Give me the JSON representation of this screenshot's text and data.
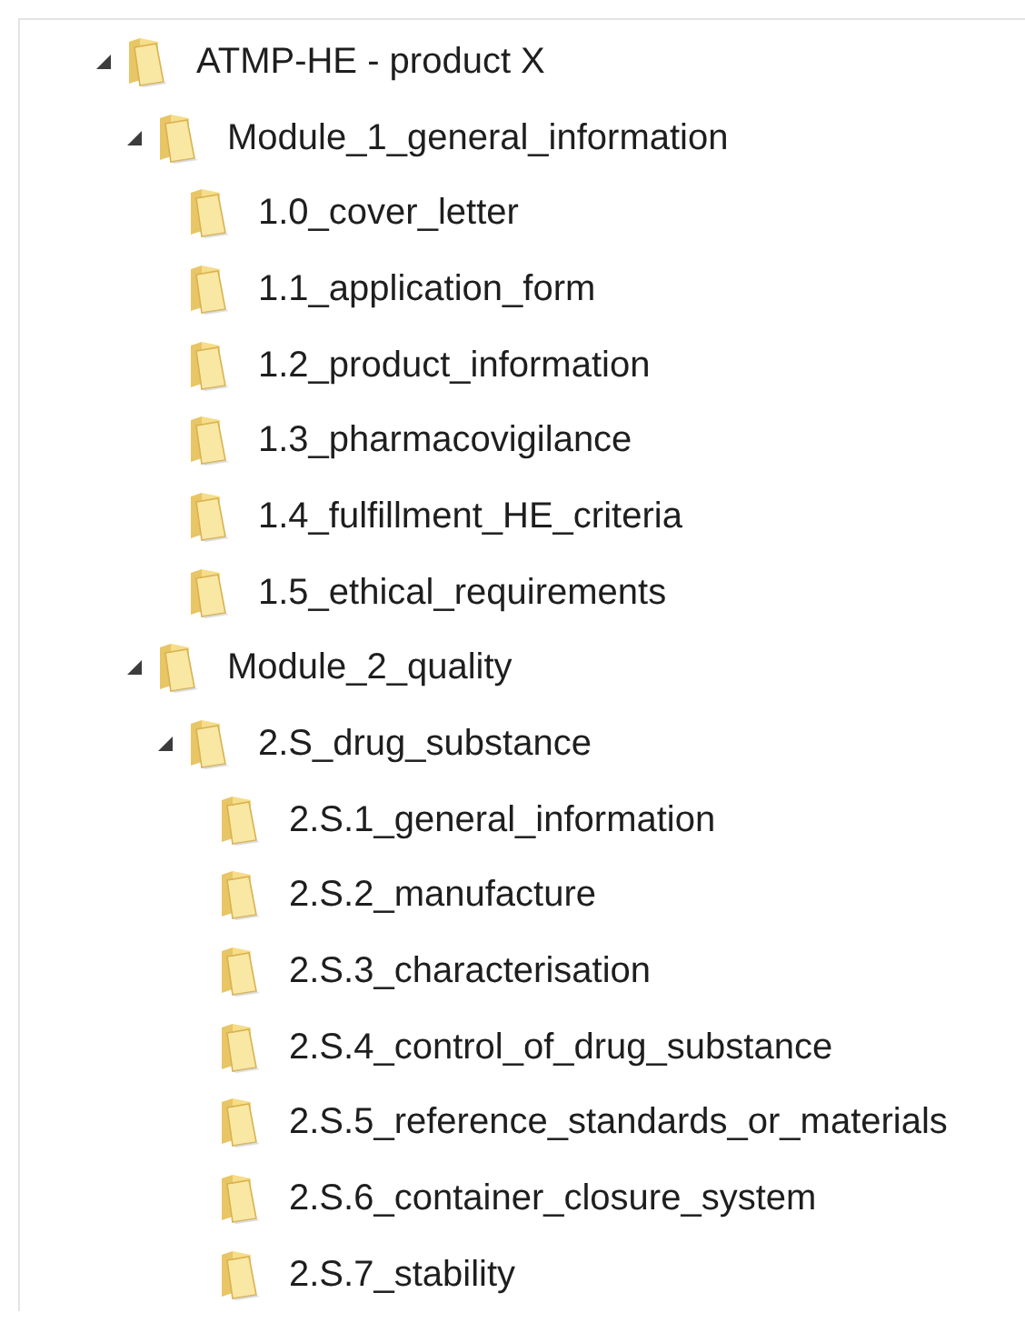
{
  "tree": [
    {
      "label": "ATMP-HE - product X",
      "expanded": true,
      "children": [
        {
          "label": "Module_1_general_information",
          "expanded": true,
          "children": [
            {
              "label": "1.0_cover_letter"
            },
            {
              "label": "1.1_application_form"
            },
            {
              "label": "1.2_product_information"
            },
            {
              "label": "1.3_pharmacovigilance"
            },
            {
              "label": "1.4_fulfillment_HE_criteria"
            },
            {
              "label": "1.5_ethical_requirements"
            }
          ]
        },
        {
          "label": "Module_2_quality",
          "expanded": true,
          "children": [
            {
              "label": "2.S_drug_substance",
              "expanded": true,
              "children": [
                {
                  "label": "2.S.1_general_information"
                },
                {
                  "label": "2.S.2_manufacture"
                },
                {
                  "label": "2.S.3_characterisation"
                },
                {
                  "label": "2.S.4_control_of_drug_substance"
                },
                {
                  "label": "2.S.5_reference_standards_or_materials"
                },
                {
                  "label": "2.S.6_container_closure_system"
                },
                {
                  "label": "2.S.7_stability"
                }
              ]
            }
          ]
        }
      ]
    }
  ]
}
